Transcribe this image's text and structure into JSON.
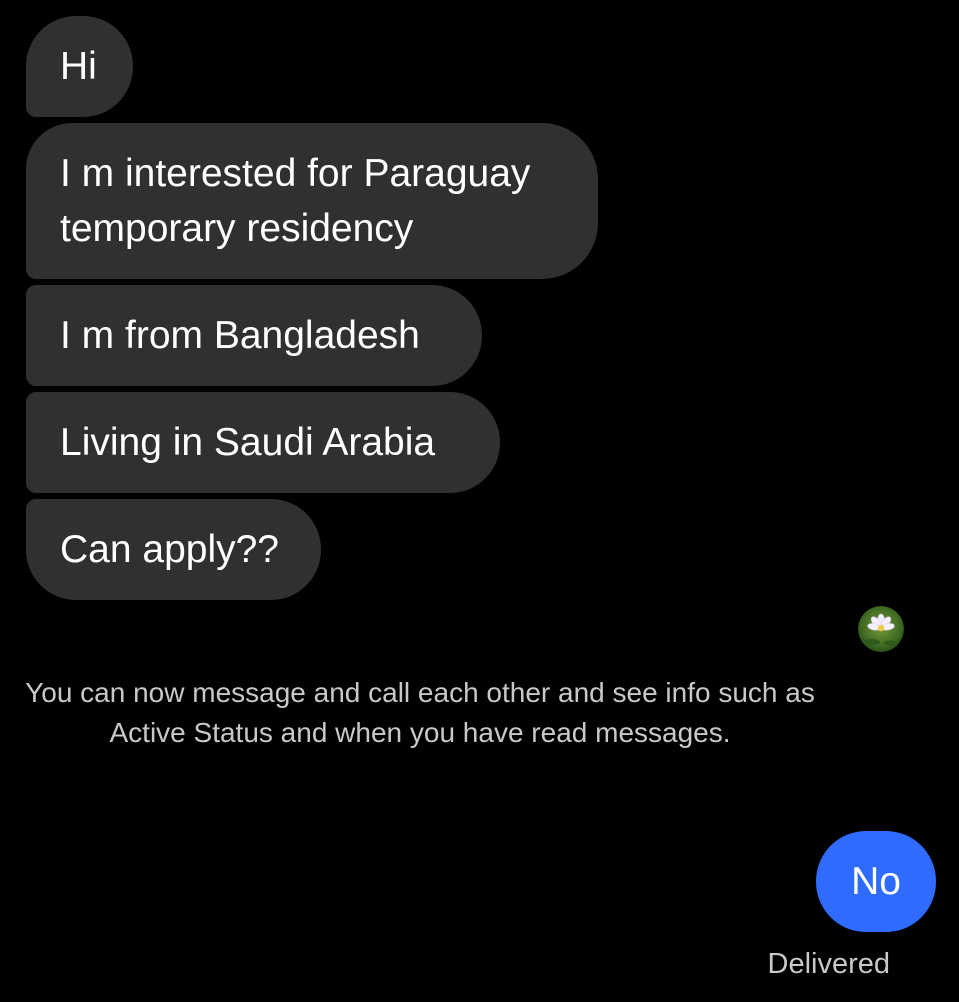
{
  "messages_received": [
    {
      "text": "Hi"
    },
    {
      "text": "I m interested for Paraguay temporary residency"
    },
    {
      "text": "I m from Bangladesh"
    },
    {
      "text": "Living in Saudi Arabia"
    },
    {
      "text": "Can apply??"
    }
  ],
  "system_note": "You can now message and call each other and see info such as Active Status and when you have read messages.",
  "messages_sent": [
    {
      "text": "No"
    }
  ],
  "delivery_status": "Delivered",
  "avatar": {
    "icon": "lotus-flower-avatar-icon"
  },
  "colors": {
    "background": "#000000",
    "received_bubble": "#303030",
    "sent_bubble": "#2f6bff",
    "muted_text": "#c8c8c8"
  }
}
